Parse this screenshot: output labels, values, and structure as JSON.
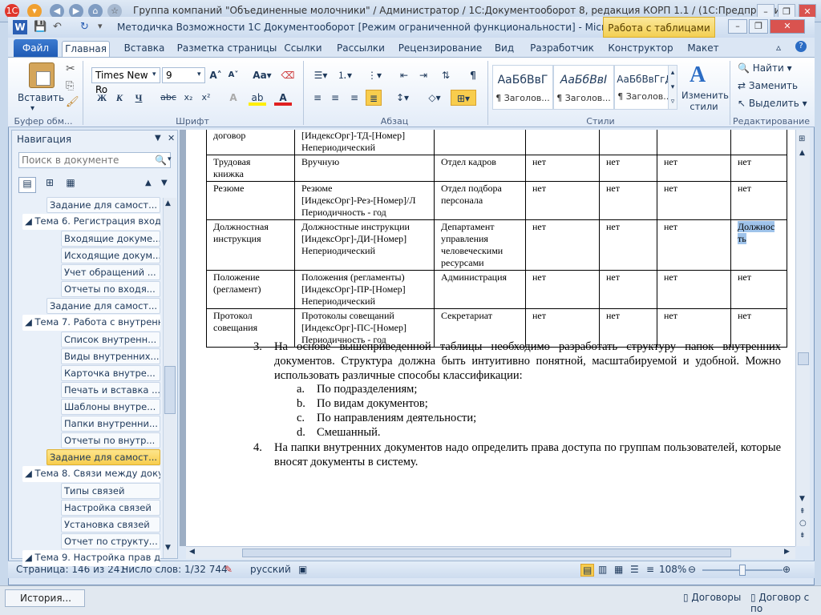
{
  "onec_title": "Группа компаний \"Объединенные молочники\" / Администратор / 1С:Документооборот 8, редакция КОРП 1.1 / (1С:Предприятие)",
  "word_title": "Методичка Возможности 1С Документооборот [Режим ограниченной функциональности] - Microsoft W...",
  "context_tab": "Работа с таблицами",
  "tabs": [
    "Файл",
    "Главная",
    "Вставка",
    "Разметка страницы",
    "Ссылки",
    "Рассылки",
    "Рецензирование",
    "Вид",
    "Разработчик",
    "Конструктор",
    "Макет"
  ],
  "ribbon": {
    "paste_label": "Вставить",
    "font_name": "Times New Ro",
    "font_size": "9",
    "groups": [
      "Буфер обм...",
      "Шрифт",
      "Абзац",
      "Стили",
      "Редактирование"
    ],
    "styles": [
      {
        "sample": "АаБбВвГ",
        "name": "¶ Заголов..."
      },
      {
        "sample": "АаБбВвІ",
        "name": "¶ Заголов..."
      },
      {
        "sample": "АаБбВвГгД",
        "name": "¶ Заголов..."
      }
    ],
    "change_styles": "Изменить стили",
    "find": "Найти",
    "replace": "Заменить",
    "select": "Выделить"
  },
  "nav": {
    "title": "Навигация",
    "search_placeholder": "Поиск в документе",
    "items": [
      {
        "text": "Задание для самост...",
        "level": 2
      },
      {
        "text": "Тема 6. Регистрация входя...",
        "level": 1
      },
      {
        "text": "Входящие докуме...",
        "level": 3
      },
      {
        "text": "Исходящие докум...",
        "level": 3
      },
      {
        "text": "Учет обращений ...",
        "level": 3
      },
      {
        "text": "Отчеты по входя...",
        "level": 3
      },
      {
        "text": "Задание для самост...",
        "level": 2
      },
      {
        "text": "Тема 7. Работа с внутренн...",
        "level": 1
      },
      {
        "text": "Список внутренн...",
        "level": 3
      },
      {
        "text": "Виды внутренних...",
        "level": 3
      },
      {
        "text": "Карточка внутре...",
        "level": 3
      },
      {
        "text": "Печать и вставка ...",
        "level": 3
      },
      {
        "text": "Шаблоны внутре...",
        "level": 3
      },
      {
        "text": "Папки внутренни...",
        "level": 3
      },
      {
        "text": "Отчеты по внутр...",
        "level": 3
      },
      {
        "text": "Задание для самост...",
        "level": 2,
        "selected": true
      },
      {
        "text": "Тема 8. Связи между доку...",
        "level": 1
      },
      {
        "text": "Типы связей",
        "level": 3
      },
      {
        "text": "Настройка связей",
        "level": 3
      },
      {
        "text": "Установка связей",
        "level": 3
      },
      {
        "text": "Отчет по структу...",
        "level": 3
      },
      {
        "text": "Тема 9. Настройка прав до...",
        "level": 1
      }
    ]
  },
  "table_rows": [
    [
      "договор",
      "[ИндексОрг]-ТД-[Номер]\nНепериодический",
      "",
      "",
      "",
      "",
      ""
    ],
    [
      "Трудовая\nкнижка",
      "Вручную",
      "Отдел кадров",
      "нет",
      "нет",
      "нет",
      "нет"
    ],
    [
      "Резюме",
      "Резюме\n[ИндексОрг]-Рез-[Номер]/Л\nПериодичность - год",
      "Отдел подбора\nперсонала",
      "нет",
      "нет",
      "нет",
      "нет"
    ],
    [
      "Должностная\nинструкция",
      "Должностные инструкции\n[ИндексОрг]-ДИ-[Номер]\nНепериодический",
      "Департамент\nуправления\nчеловеческими\nресурсами",
      "нет",
      "нет",
      "нет",
      "Должнос\nть"
    ],
    [
      "Положение\n(регламент)",
      "Положения (регламенты)\n[ИндексОрг]-ПР-[Номер]\nНепериодический",
      "Администрация",
      "нет",
      "нет",
      "нет",
      "нет"
    ],
    [
      "Протокол\nсовещания",
      "Протоколы совещаний\n[ИндексОрг]-ПС-[Номер]\nПериодичность - год",
      "Секретариат",
      "нет",
      "нет",
      "нет",
      "нет"
    ]
  ],
  "list": {
    "item3_num": "3.",
    "item3": "На основе вышеприведенной таблицы необходимо разработать структуру папок внутренних документов. Структура должна быть интуитивно понятной, масштабируемой и удобной. Можно использовать различные способы классификации:",
    "sub": [
      {
        "n": "a.",
        "t": "По подразделениям;"
      },
      {
        "n": "b.",
        "t": "По видам документов;"
      },
      {
        "n": "c.",
        "t": "По направлениям деятельности;"
      },
      {
        "n": "d.",
        "t": "Смешанный."
      }
    ],
    "item4_num": "4.",
    "item4": "На папки внутренних документов надо определить права доступа по группам пользователей, которые вносят документы в систему."
  },
  "status": {
    "page": "Страница: 146 из 241",
    "words": "Число слов: 1/32 744",
    "lang": "русский",
    "zoom": "108%"
  },
  "bottom": {
    "history": "История...",
    "link1": "Договоры",
    "link2": "Договор с по"
  }
}
